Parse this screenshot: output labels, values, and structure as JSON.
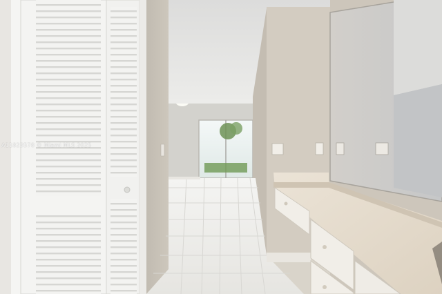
{
  "photo": {
    "subject": "hallway with louvered closet doors and vanity",
    "watermark_text": "A11823578 © Miami MLS 2025"
  },
  "colors": {
    "wall": "#cfc8bd",
    "ceiling": "#e2e2e0",
    "floor_tile": "#eeeeec",
    "closet_door": "#f2f2f0",
    "counter": "#e6dccd",
    "cabinet": "#efece6",
    "mirror_wall": "#c9c8c6",
    "window_glass": "#cfe0de",
    "greenery": "#5f8a4a"
  }
}
